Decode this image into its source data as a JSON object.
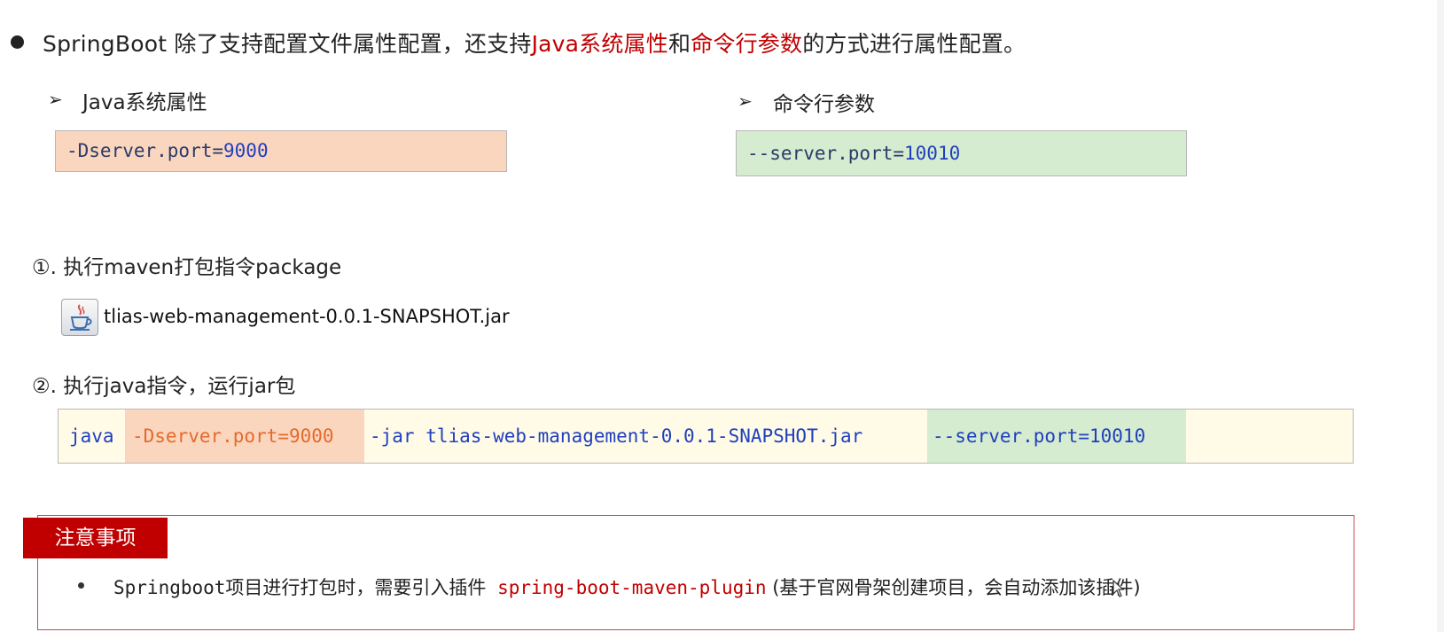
{
  "headline": {
    "part1": "SpringBoot 除了支持配置文件属性配置，还支持",
    "highlight1": "Java系统属性",
    "part2": "和",
    "highlight2": "命令行参数",
    "part3": "的方式进行属性配置。"
  },
  "left_section": {
    "arrow": "➢",
    "title": "Java系统属性",
    "code_key": "-Dserver.port=",
    "code_value": "9000"
  },
  "right_section": {
    "arrow": "➢",
    "title": "命令行参数",
    "code_key": "--server.port=",
    "code_value": "10010"
  },
  "steps": [
    {
      "label": "①. 执行maven打包指令package"
    },
    {
      "label": "②. 执行java指令，运行jar包"
    }
  ],
  "jar_file": {
    "icon": "java-jar-icon",
    "name": "tlias-web-management-0.0.1-SNAPSHOT.jar"
  },
  "command": {
    "java": "java",
    "system_prop": "-Dserver.port=9000",
    "jar_part": "-jar tlias-web-management-0.0.1-SNAPSHOT.jar",
    "cli_arg": "--server.port=10010"
  },
  "note": {
    "tag": "注意事项",
    "text_before": "Springboot项目进行打包时，需要引入插件 ",
    "plugin": "spring-boot-maven-plugin",
    "text_after": " (基于官网骨架创建项目，会自动添加该插件)"
  },
  "colors": {
    "accent_red": "#c00000",
    "orange_fill": "#fbd6bf",
    "green_fill": "#d5ecd0",
    "cmd_fill": "#fffbe6"
  }
}
